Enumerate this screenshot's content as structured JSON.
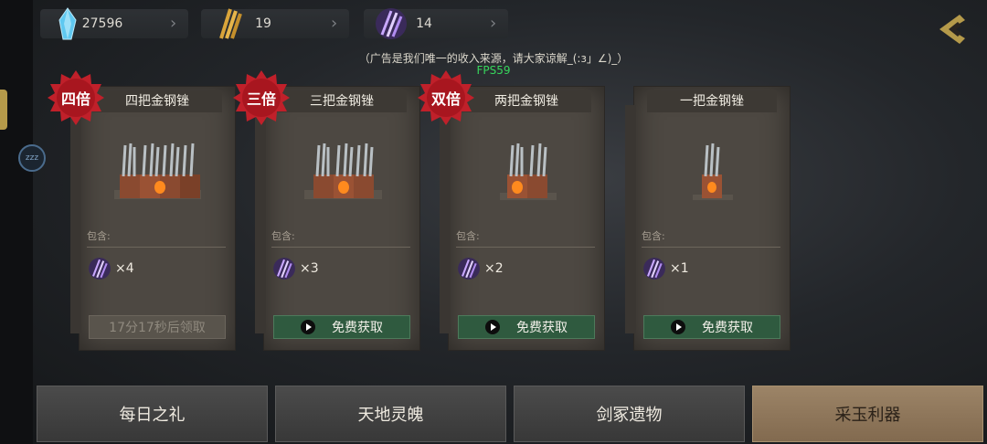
{
  "resources": [
    {
      "icon": "crystal-icon",
      "value": "27596"
    },
    {
      "icon": "golden-spikes-icon",
      "value": "19"
    },
    {
      "icon": "purple-claws-icon",
      "value": "14"
    }
  ],
  "notice": "（广告是我们唯一的收入来源，请大家谅解_(:з」∠)_）",
  "fps": "FPS59",
  "side_badge": "zzz",
  "cards": [
    {
      "title": "四把金钢锉",
      "multiplier": "四倍",
      "contain_label": "包含:",
      "quantity": "×4",
      "button": "17分17秒后领取",
      "available": false
    },
    {
      "title": "三把金钢锉",
      "multiplier": "三倍",
      "contain_label": "包含:",
      "quantity": "×3",
      "button": "免费获取",
      "available": true
    },
    {
      "title": "两把金钢锉",
      "multiplier": "双倍",
      "contain_label": "包含:",
      "quantity": "×2",
      "button": "免费获取",
      "available": true
    },
    {
      "title": "一把金钢锉",
      "multiplier": "",
      "contain_label": "包含:",
      "quantity": "×1",
      "button": "免费获取",
      "available": true
    }
  ],
  "tabs": [
    {
      "label": "每日之礼",
      "active": false
    },
    {
      "label": "天地灵魄",
      "active": false
    },
    {
      "label": "剑冢遗物",
      "active": false
    },
    {
      "label": "采玉利器",
      "active": true
    }
  ],
  "colors": {
    "accent_gold": "#b59a4a",
    "button_green": "#2f5a3f",
    "badge_red": "#c0202a",
    "fps_green": "#37d65c",
    "active_tab": "#9c8467"
  }
}
